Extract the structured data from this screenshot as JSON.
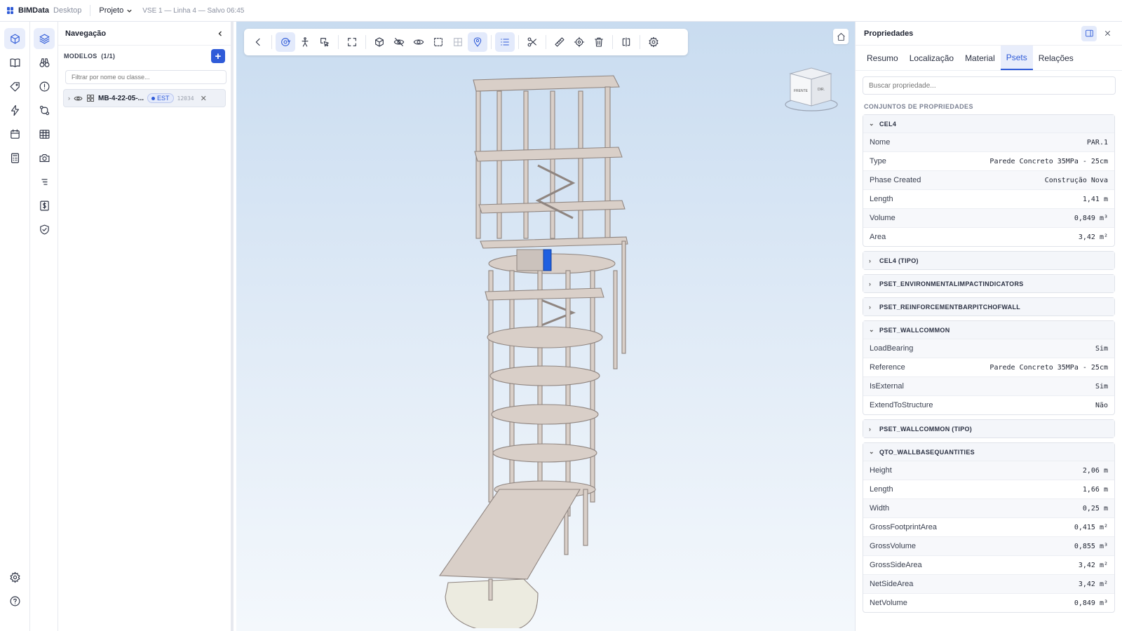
{
  "app": {
    "brand": "BIMData",
    "brand_sub": "Desktop",
    "project_menu": "Projeto",
    "status": "VSE 1 — Linha 4 — Salvo 06:45"
  },
  "navigation": {
    "title": "Navegação",
    "models_label": "MODELOS",
    "models_count": "(1/1)",
    "add_label": "+",
    "filter_placeholder": "Filtrar por nome ou classe...",
    "model": {
      "name": "MB-4-22-05-...",
      "badge": "EST",
      "count": "12034"
    }
  },
  "properties": {
    "title": "Propriedades",
    "tabs": [
      {
        "label": "Resumo"
      },
      {
        "label": "Localização"
      },
      {
        "label": "Material"
      },
      {
        "label": "Psets"
      },
      {
        "label": "Relações"
      }
    ],
    "search_placeholder": "Buscar propriedade...",
    "section_title": "CONJUNTOS DE PROPRIEDADES",
    "psets": [
      {
        "name": "CEL4",
        "rows": [
          {
            "k": "Nome",
            "v": "PAR.1"
          },
          {
            "k": "Type",
            "v": "Parede Concreto 35MPa - 25cm"
          },
          {
            "k": "Phase Created",
            "v": "Construção Nova"
          },
          {
            "k": "Length",
            "v": "1,41 m"
          },
          {
            "k": "Volume",
            "v": "0,849 m³"
          },
          {
            "k": "Area",
            "v": "3,42 m²"
          }
        ]
      },
      {
        "name": "CEL4 (TIPO)"
      },
      {
        "name": "PSET_ENVIRONMENTALIMPACTINDICATORS"
      },
      {
        "name": "PSET_REINFORCEMENTBARPITCHOFWALL"
      },
      {
        "name": "PSET_WALLCOMMON",
        "rows": [
          {
            "k": "LoadBearing",
            "v": "Sim"
          },
          {
            "k": "Reference",
            "v": "Parede Concreto 35MPa - 25cm"
          },
          {
            "k": "IsExternal",
            "v": "Sim"
          },
          {
            "k": "ExtendToStructure",
            "v": "Não"
          }
        ]
      },
      {
        "name": "PSET_WALLCOMMON (TIPO)"
      },
      {
        "name": "QTO_WALLBASEQUANTITIES",
        "rows": [
          {
            "k": "Height",
            "v": "2,06 m"
          },
          {
            "k": "Length",
            "v": "1,66 m"
          },
          {
            "k": "Width",
            "v": "0,25 m"
          },
          {
            "k": "GrossFootprintArea",
            "v": "0,415 m²"
          },
          {
            "k": "GrossVolume",
            "v": "0,855 m³"
          },
          {
            "k": "GrossSideArea",
            "v": "3,42 m²"
          },
          {
            "k": "NetSideArea",
            "v": "3,42 m²"
          },
          {
            "k": "NetVolume",
            "v": "0,849 m³"
          }
        ]
      }
    ]
  },
  "viewcube": {
    "front": "FRENTE",
    "right": "DIR."
  },
  "colors": {
    "accent": "#2f5bd8",
    "model": "#d9cfc8",
    "selected": "#1f5fe0"
  }
}
